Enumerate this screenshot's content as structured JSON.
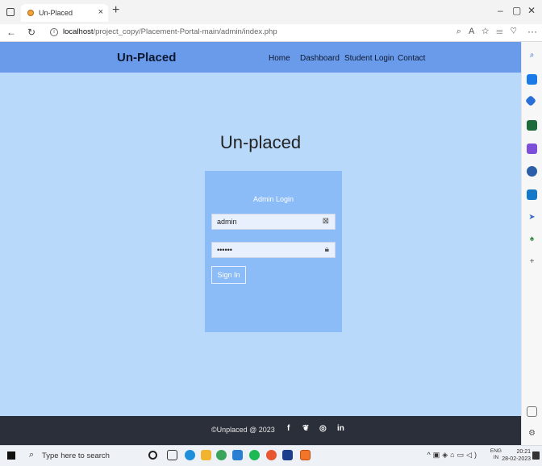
{
  "browser": {
    "tab_title": "Un-Placed",
    "tab_close": "×",
    "new_tab": "+",
    "window_min": "–",
    "window_max": "▢",
    "window_close": "✕",
    "url_host": "localhost",
    "url_path": "/project_copy/Placement-Portal-main/admin/index.php",
    "more_label": "···"
  },
  "site": {
    "brand": "Un-Placed",
    "nav": [
      "Home",
      "Dashboard",
      "Student Login",
      "Contact"
    ],
    "hero_title": "Un-placed",
    "login": {
      "title": "Admin Login",
      "username_value": "admin",
      "password_value": "••••••",
      "submit_label": "Sign In"
    },
    "footer": {
      "copyright": "©Unplaced @ 2023",
      "social": [
        "f",
        "❦",
        "◎",
        "in"
      ]
    }
  },
  "taskbar": {
    "search_placeholder": "Type here to search",
    "lang_line1": "ENG",
    "lang_line2": "IN",
    "time": "20:21",
    "date": "28-02-2023"
  },
  "colors": {
    "nav_bg": "#6a9bea",
    "page_bg": "#b9d9fb",
    "card_bg": "#8cbcf8",
    "footer_bg": "#2b2f3a"
  }
}
